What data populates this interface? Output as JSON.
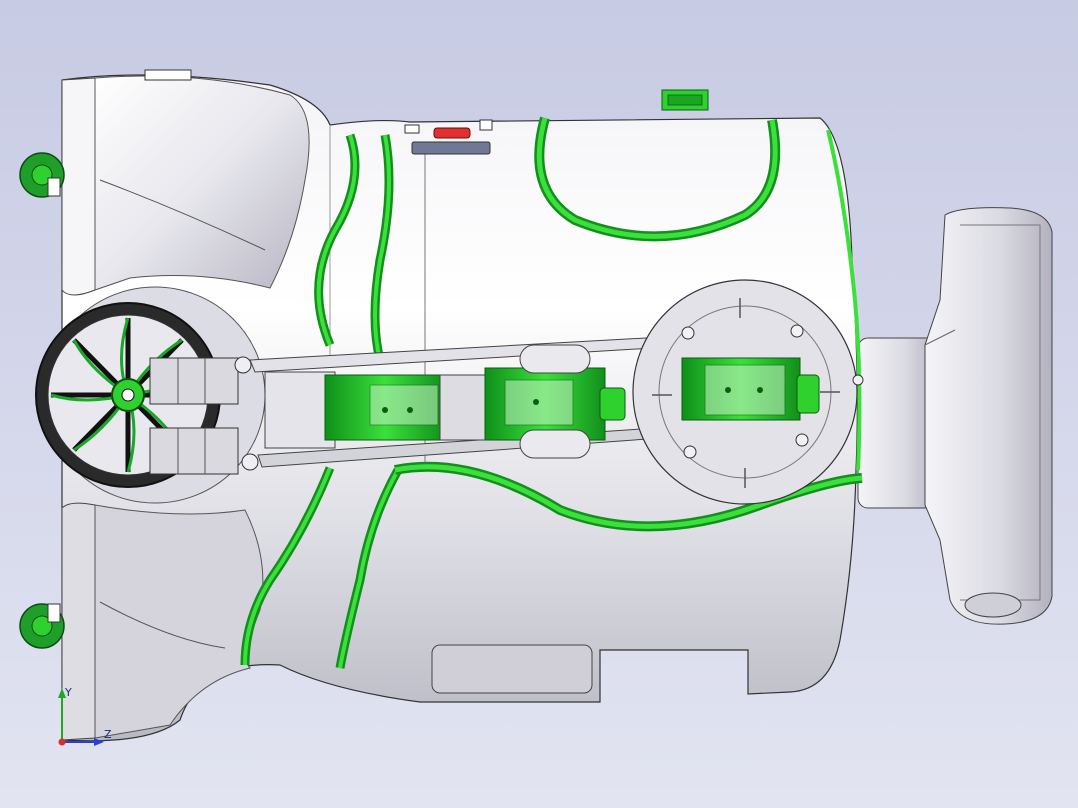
{
  "scene": {
    "background_top": "#c7cbe3",
    "background_bottom": "#e2e4f1",
    "body_color": "#e9e9ee",
    "accent_color": "#2fd12f",
    "accent_dark": "#0f8f1a",
    "indicator_red": "#e03030",
    "outline_color": "#333333"
  },
  "triad": {
    "y_label": "Y",
    "z_label": "Z",
    "y_color": "#22a722",
    "z_color": "#2a3fd6",
    "x_color": "#d63030"
  }
}
